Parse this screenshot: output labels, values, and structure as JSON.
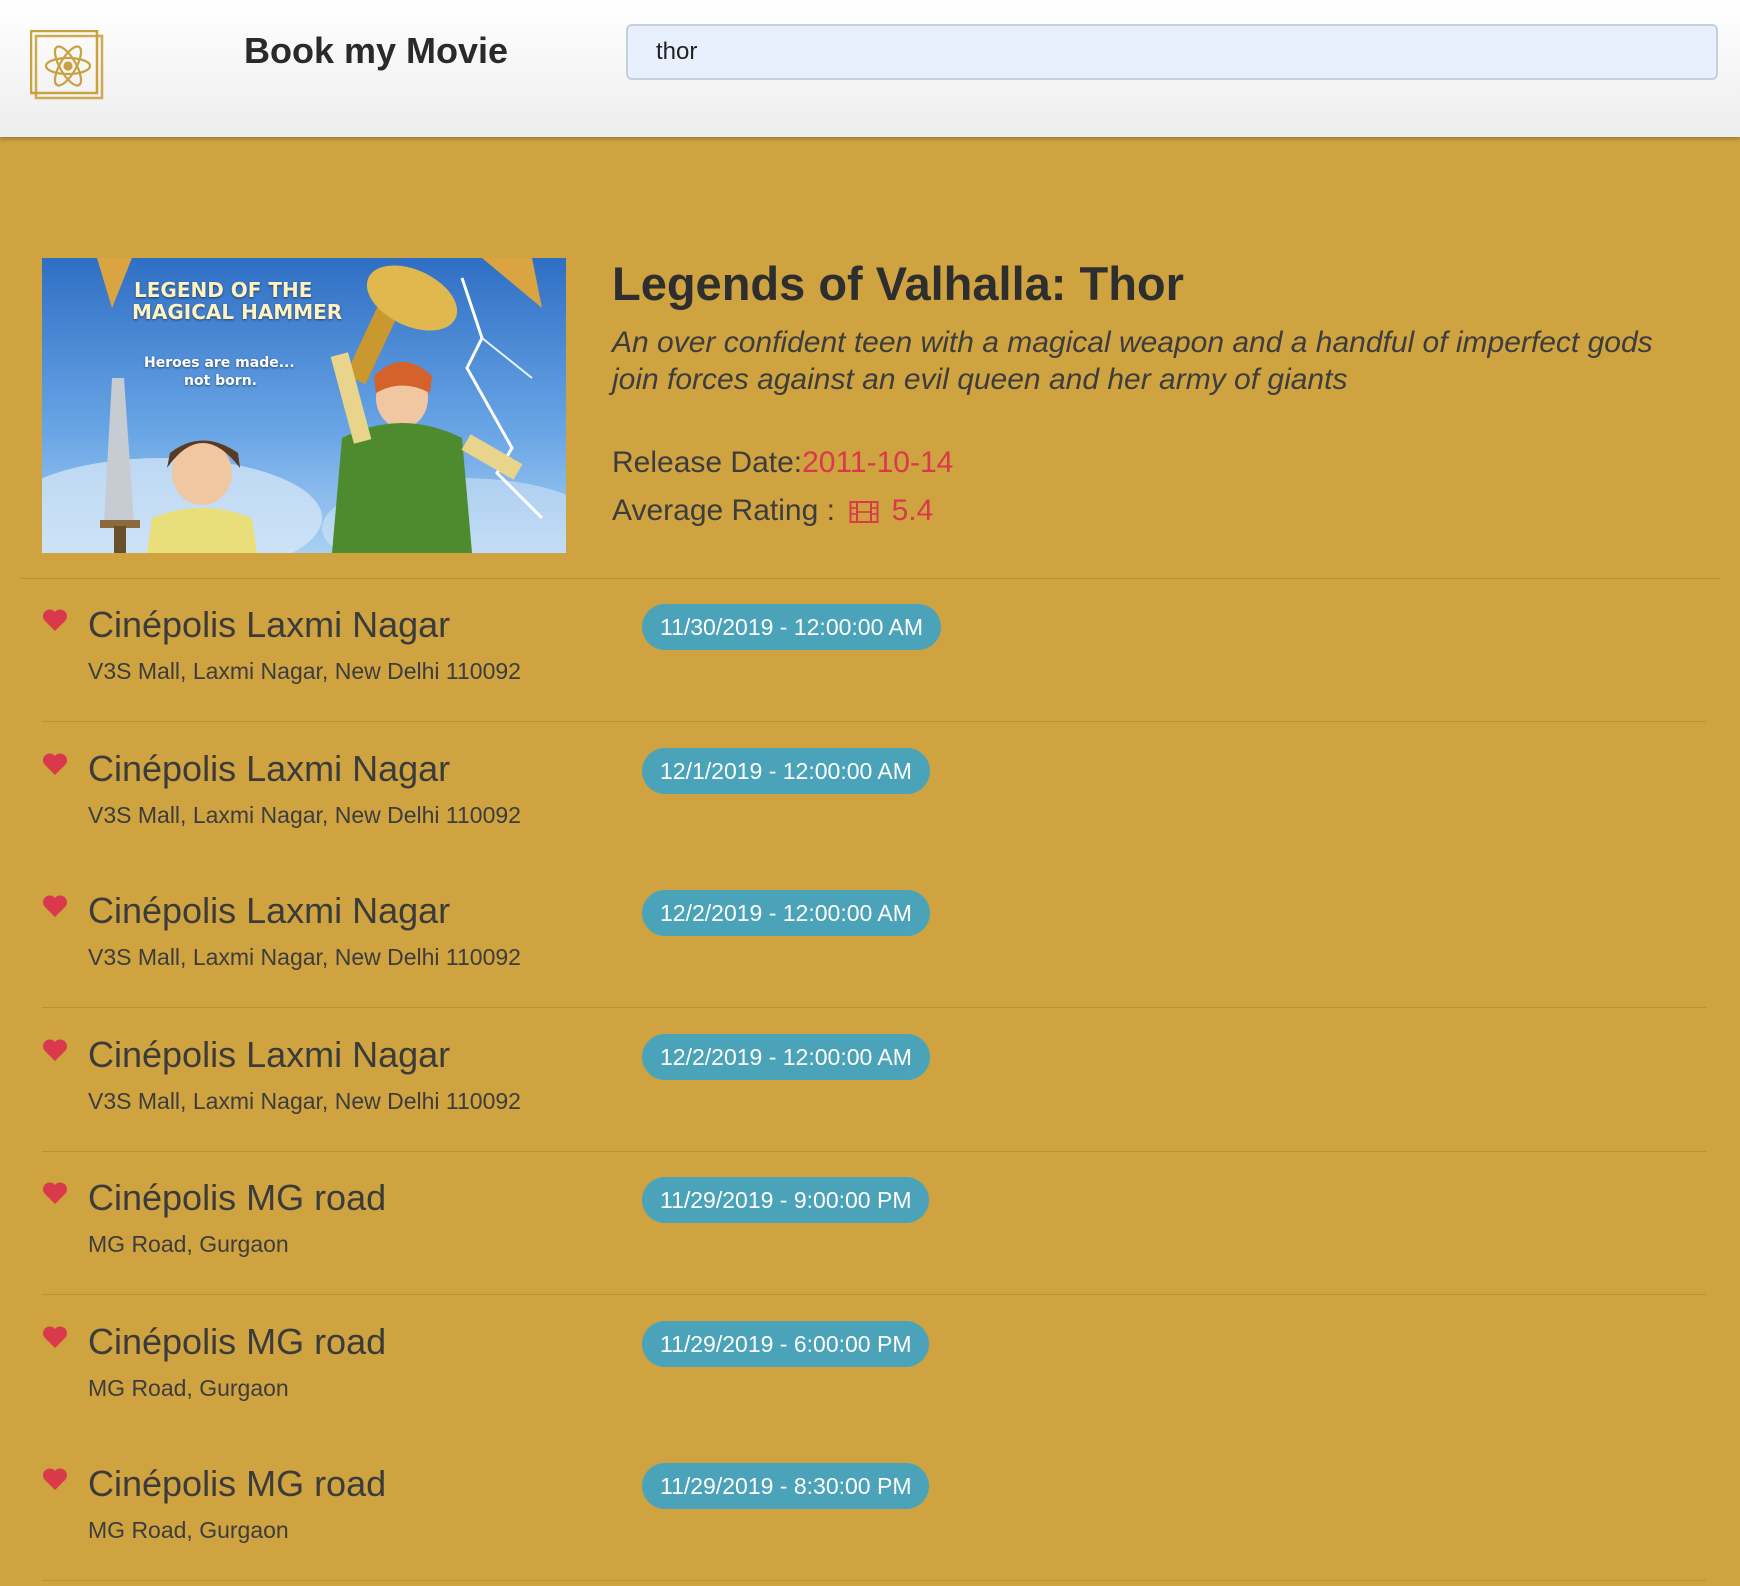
{
  "header": {
    "brand": "Book my Movie",
    "logo_icon": "atom-logo-icon",
    "search": {
      "value": "thor",
      "placeholder": ""
    }
  },
  "movie": {
    "title": "Legends of Valhalla: Thor",
    "description": "An over confident teen with a magical weapon and a handful of imperfect gods join forces against an evil queen and her army of giants",
    "release_label": "Release Date:",
    "release_date": "2011-10-14",
    "rating_label": "Average Rating :",
    "rating_icon": "film-icon",
    "rating": "5.4",
    "poster": {
      "title_line1": "LEGEND OF THE",
      "title_line2": "MAGICAL HAMMER",
      "tagline_line1": "Heroes are made...",
      "tagline_line2": "not born."
    }
  },
  "colors": {
    "background": "#cea340",
    "accent": "#d9394a",
    "showtime_badge": "#4aa3b8"
  },
  "shows": [
    {
      "theatre": "Cinépolis Laxmi Nagar",
      "address": "V3S Mall, Laxmi Nagar, New Delhi 110092",
      "time": "11/30/2019 - 12:00:00 AM",
      "icon": "heart-icon"
    },
    {
      "theatre": "Cinépolis Laxmi Nagar",
      "address": "V3S Mall, Laxmi Nagar, New Delhi 110092",
      "time": "12/1/2019 - 12:00:00 AM",
      "icon": "heart-icon"
    },
    {
      "theatre": "Cinépolis Laxmi Nagar",
      "address": "V3S Mall, Laxmi Nagar, New Delhi 110092",
      "time": "12/2/2019 - 12:00:00 AM",
      "icon": "heart-icon"
    },
    {
      "theatre": "Cinépolis Laxmi Nagar",
      "address": "V3S Mall, Laxmi Nagar, New Delhi 110092",
      "time": "12/2/2019 - 12:00:00 AM",
      "icon": "heart-icon"
    },
    {
      "theatre": "Cinépolis MG road",
      "address": "MG Road, Gurgaon",
      "time": "11/29/2019 - 9:00:00 PM",
      "icon": "heart-icon"
    },
    {
      "theatre": "Cinépolis MG road",
      "address": "MG Road, Gurgaon",
      "time": "11/29/2019 - 6:00:00 PM",
      "icon": "heart-icon"
    },
    {
      "theatre": "Cinépolis MG road",
      "address": "MG Road, Gurgaon",
      "time": "11/29/2019 - 8:30:00 PM",
      "icon": "heart-icon"
    }
  ]
}
